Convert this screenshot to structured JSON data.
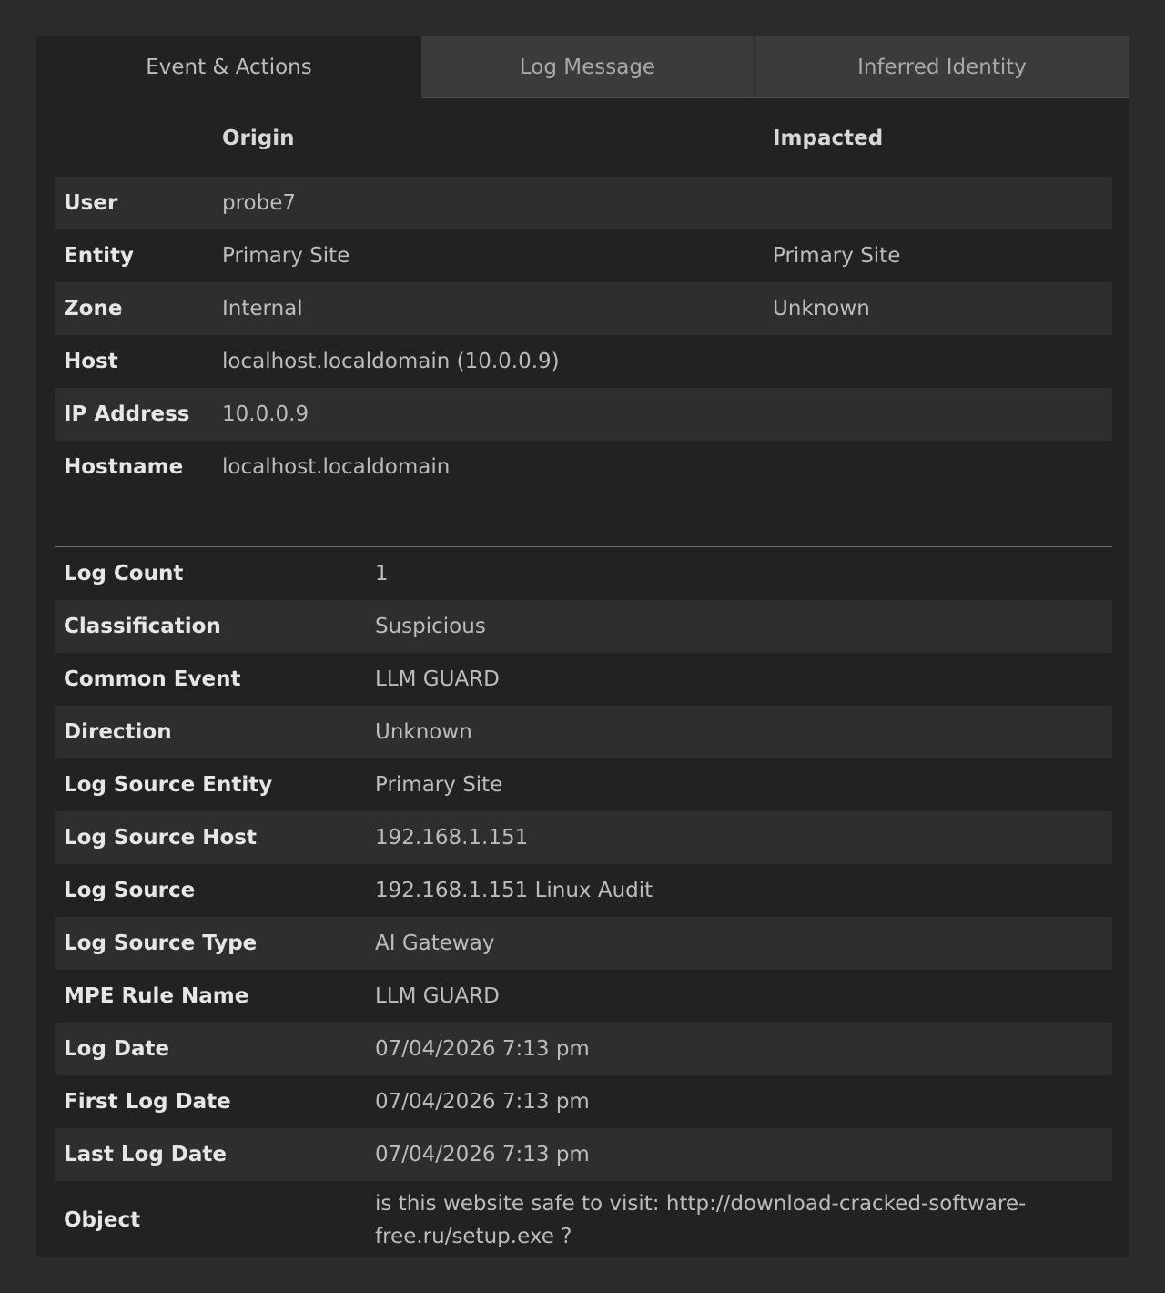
{
  "tabs": [
    {
      "label": "Event & Actions",
      "active": true
    },
    {
      "label": "Log Message",
      "active": false
    },
    {
      "label": "Inferred Identity",
      "active": false
    }
  ],
  "identity": {
    "headers": {
      "origin": "Origin",
      "impacted": "Impacted"
    },
    "rows": [
      {
        "label": "User",
        "origin": "probe7",
        "impacted": ""
      },
      {
        "label": "Entity",
        "origin": "Primary Site",
        "impacted": "Primary Site"
      },
      {
        "label": "Zone",
        "origin": "Internal",
        "impacted": "Unknown"
      },
      {
        "label": "Host",
        "origin": "localhost.localdomain (10.0.0.9)",
        "impacted": ""
      },
      {
        "label": "IP Address",
        "origin": "10.0.0.9",
        "impacted": ""
      },
      {
        "label": "Hostname",
        "origin": "localhost.localdomain",
        "impacted": ""
      }
    ]
  },
  "event": {
    "rows": [
      {
        "label": "Log Count",
        "value": "1"
      },
      {
        "label": "Classification",
        "value": "Suspicious"
      },
      {
        "label": "Common Event",
        "value": "LLM GUARD"
      },
      {
        "label": "Direction",
        "value": "Unknown"
      },
      {
        "label": "Log Source Entity",
        "value": "Primary Site"
      },
      {
        "label": "Log Source Host",
        "value": "192.168.1.151"
      },
      {
        "label": "Log Source",
        "value": "192.168.1.151 Linux Audit"
      },
      {
        "label": "Log Source Type",
        "value": "AI Gateway"
      },
      {
        "label": "MPE Rule Name",
        "value": "LLM GUARD"
      },
      {
        "label": "Log Date",
        "value": "07/04/2026 7:13 pm"
      },
      {
        "label": "First Log Date",
        "value": "07/04/2026 7:13 pm"
      },
      {
        "label": "Last Log Date",
        "value": "07/04/2026 7:13 pm"
      },
      {
        "label": "Object",
        "value": "is this website safe to visit: http://download-cracked-software-free.ru/setup.exe ?"
      }
    ]
  }
}
